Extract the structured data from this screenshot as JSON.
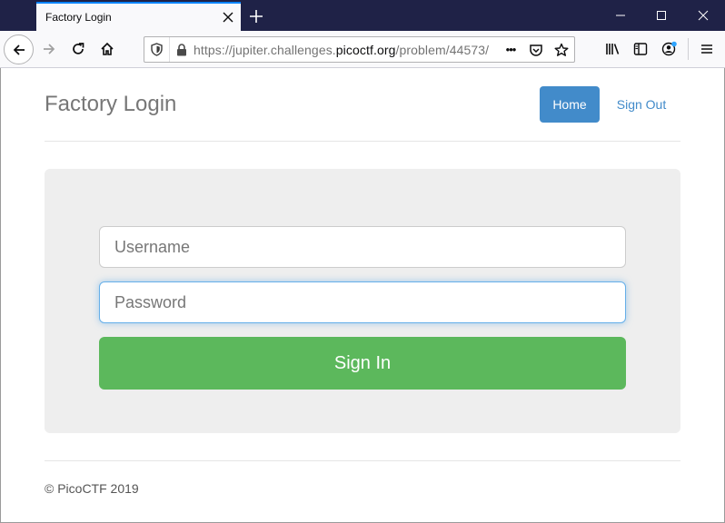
{
  "browser": {
    "tab_title": "Factory Login",
    "url_prefix": "https://jupiter.challenges.",
    "url_host": "picoctf.org",
    "url_path": "/problem/44573/",
    "more_glyph": "•••"
  },
  "header": {
    "brand": "Factory Login",
    "nav": {
      "home_label": "Home",
      "signout_label": "Sign Out"
    }
  },
  "form": {
    "username_placeholder": "Username",
    "password_placeholder": "Password",
    "submit_label": "Sign In"
  },
  "footer": {
    "text": "© PicoCTF 2019"
  },
  "colors": {
    "titlebar": "#1f2247",
    "home_button": "#428bca",
    "signin_button": "#5cb85c",
    "jumbotron": "#eeeeee",
    "focus_ring": "#66afe9"
  },
  "icons": {
    "tab_close": "close-icon",
    "new_tab": "plus-icon",
    "minimize": "minimize-icon",
    "maximize": "maximize-icon",
    "window_close": "window-close-icon",
    "back": "back-arrow-icon",
    "forward": "forward-arrow-icon",
    "reload": "reload-icon",
    "home": "home-icon",
    "shield": "shield-icon",
    "lock": "lock-icon",
    "page_actions": "ellipsis-icon",
    "pocket": "pocket-icon",
    "bookmark": "star-icon",
    "library": "library-icon",
    "sidebar": "sidebar-icon",
    "account": "account-icon",
    "menu": "hamburger-menu-icon"
  }
}
